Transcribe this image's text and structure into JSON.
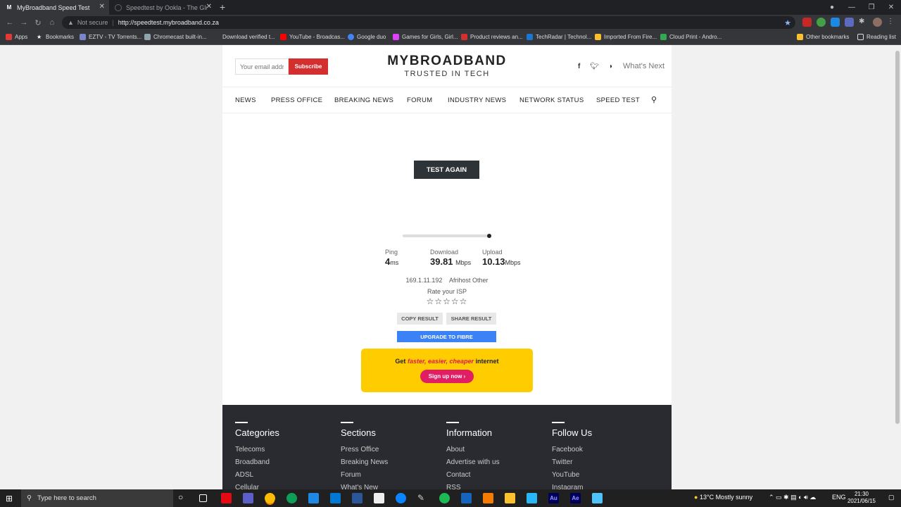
{
  "browser": {
    "tabs": [
      {
        "title": "MyBroadband Speed Test",
        "favicon": "M",
        "active": true
      },
      {
        "title": "Speedtest by Ookla - The Global",
        "favicon": "",
        "active": false
      }
    ],
    "security": "Not secure",
    "url": "http://speedtest.mybroadband.co.za",
    "bookmarks": [
      "Apps",
      "Bookmarks",
      "EZTV - TV Torrents...",
      "Chromecast built-in...",
      "Download verified t...",
      "YouTube - Broadcas...",
      "Google duo",
      "Games for Girls, Girl...",
      "Product reviews an...",
      "TechRadar | Technol...",
      "Imported From Fire...",
      "Cloud Print - Andro...",
      "Other bookmarks",
      "Reading list"
    ]
  },
  "header": {
    "email_placeholder": "Your email address",
    "subscribe_label": "Subscribe",
    "logo_name": "MYBROADBAND",
    "logo_tagline": "TRUSTED IN TECH",
    "whats_next": "What's Next"
  },
  "nav": [
    "NEWS",
    "PRESS OFFICE",
    "BREAKING NEWS",
    "FORUM",
    "INDUSTRY NEWS",
    "NETWORK STATUS",
    "SPEED TEST"
  ],
  "speedtest": {
    "test_again_label": "TEST AGAIN",
    "progress": 1.0,
    "ping_label": "Ping",
    "ping_value": "4",
    "ping_unit": "ms",
    "download_label": "Download",
    "download_value": "39.81",
    "download_unit": "Mbps",
    "upload_label": "Upload",
    "upload_value": "10.13",
    "upload_unit": "Mbps",
    "ip": "169.1.11.192",
    "isp": "Afrihost Other",
    "rate_label": "Rate your ISP",
    "stars": "☆☆☆☆☆",
    "copy_label": "COPY RESULT",
    "share_label": "SHARE RESULT",
    "fibre_label": "UPGRADE TO FIBRE"
  },
  "promo": {
    "get": "Get",
    "highlight": "faster, easier, cheaper",
    "rest": "internet",
    "signup": "Sign up now"
  },
  "footer": {
    "columns": [
      {
        "head": "Categories",
        "links": [
          "Telecoms",
          "Broadband",
          "ADSL",
          "Cellular"
        ]
      },
      {
        "head": "Sections",
        "links": [
          "Press Office",
          "Breaking News",
          "Forum",
          "What's New"
        ]
      },
      {
        "head": "Information",
        "links": [
          "About",
          "Advertise with us",
          "Contact",
          "RSS"
        ]
      },
      {
        "head": "Follow Us",
        "links": [
          "Facebook",
          "Twitter",
          "YouTube",
          "Instagram"
        ]
      }
    ]
  },
  "taskbar": {
    "search_placeholder": "Type here to search",
    "weather": "13°C  Mostly sunny",
    "lang": "ENG",
    "time": "21:30",
    "date": "2021/06/15"
  },
  "colors": {
    "accent_red": "#d32f2f",
    "promo_yellow": "#ffcc00",
    "fibre_blue": "#3b82f6",
    "footer_dark": "#2a2b30"
  }
}
